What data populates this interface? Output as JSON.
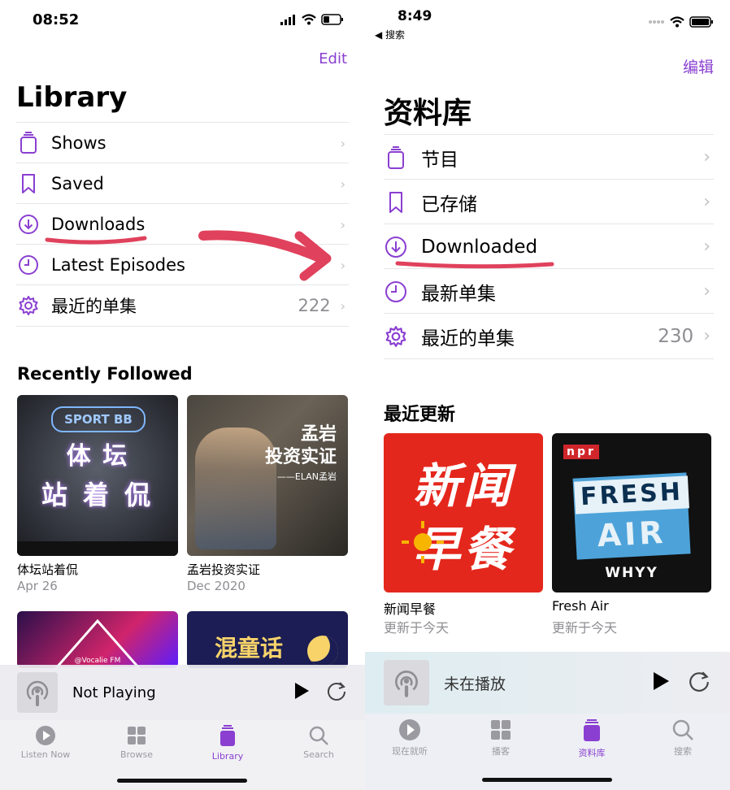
{
  "left": {
    "status": {
      "time": "08:52"
    },
    "nav": {
      "edit": "Edit"
    },
    "title": "Library",
    "rows": [
      {
        "icon": "shows-icon",
        "label": "Shows",
        "count": ""
      },
      {
        "icon": "bookmark-icon",
        "label": "Saved",
        "count": ""
      },
      {
        "icon": "download-icon",
        "label": "Downloads",
        "count": ""
      },
      {
        "icon": "clock-icon",
        "label": "Latest Episodes",
        "count": ""
      },
      {
        "icon": "gear-icon",
        "label": "最近的单集",
        "count": "222"
      }
    ],
    "section_title": "Recently Followed",
    "cards": [
      {
        "name": "体坛站着侃",
        "sub": "Apr 26",
        "art_badge": "SPORT BB",
        "art_line1": "体 坛",
        "art_line2": "站 着 侃"
      },
      {
        "name": "孟岩投资实证",
        "sub": "Dec 2020",
        "art_line1": "孟岩",
        "art_line2": "投资实证",
        "art_line3": "——ELAN孟岩"
      }
    ],
    "partial_cards": [
      {
        "art_text": "@Vocalie FM"
      },
      {
        "art_text": "混童话"
      }
    ],
    "player": {
      "status": "Not Playing"
    },
    "tabs": [
      {
        "label": "Listen Now",
        "icon": "play-circle-icon"
      },
      {
        "label": "Browse",
        "icon": "grid-icon"
      },
      {
        "label": "Library",
        "icon": "library-icon",
        "active": true
      },
      {
        "label": "Search",
        "icon": "search-icon"
      }
    ]
  },
  "right": {
    "status": {
      "time": "8:49",
      "back": "◀ 搜索"
    },
    "nav": {
      "edit": "编辑"
    },
    "title": "资料库",
    "rows": [
      {
        "icon": "shows-icon",
        "label": "节目",
        "count": ""
      },
      {
        "icon": "bookmark-icon",
        "label": "已存储",
        "count": ""
      },
      {
        "icon": "download-icon",
        "label": "Downloaded",
        "count": ""
      },
      {
        "icon": "clock-icon",
        "label": "最新单集",
        "count": ""
      },
      {
        "icon": "gear-icon",
        "label": "最近的单集",
        "count": "230"
      }
    ],
    "section_title": "最近更新",
    "cards": [
      {
        "name": "新闻早餐",
        "sub": "更新于今天",
        "art_line1": "新闻",
        "art_line2": "早餐"
      },
      {
        "name": "Fresh Air",
        "sub": "更新于今天",
        "art_npr": "npr",
        "art_line1": "FRESH",
        "art_line2": "AIR",
        "art_line3": "WHYY"
      }
    ],
    "player": {
      "status": "未在播放"
    },
    "tabs": [
      {
        "label": "现在就听",
        "icon": "play-circle-icon"
      },
      {
        "label": "播客",
        "icon": "grid-icon"
      },
      {
        "label": "资料库",
        "icon": "library-icon",
        "active": true
      },
      {
        "label": "搜索",
        "icon": "search-icon"
      }
    ]
  },
  "colors": {
    "accent": "#8a3fd1",
    "annotation": "#e0415c",
    "secondary": "#8e8e93"
  }
}
